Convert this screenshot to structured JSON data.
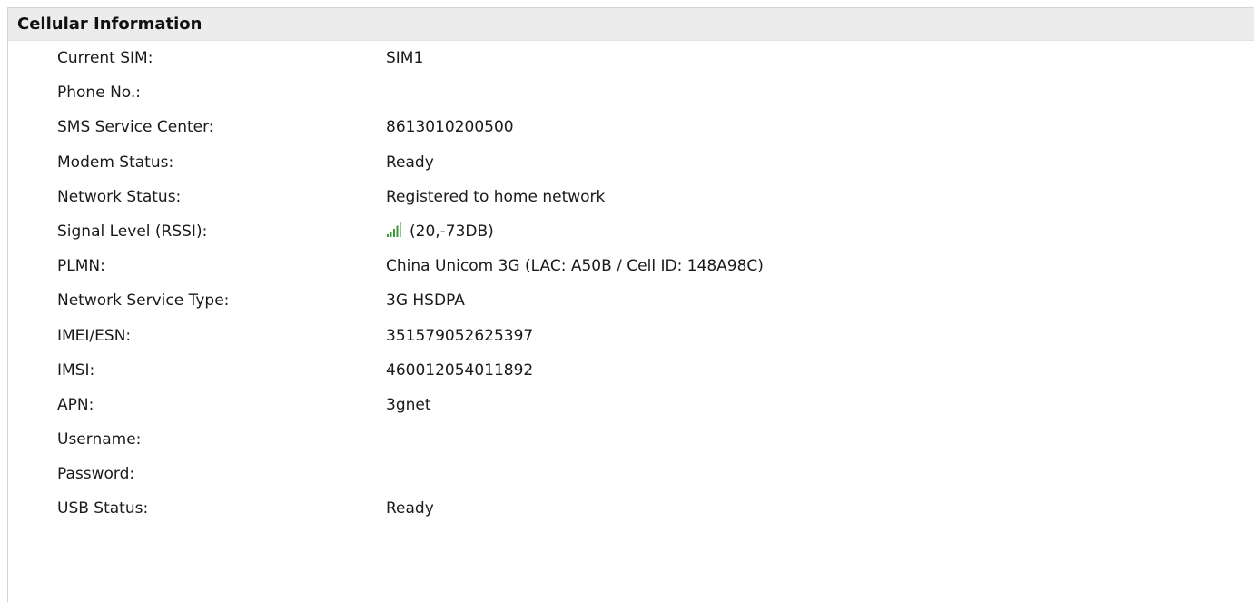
{
  "panel": {
    "title": "Cellular Information"
  },
  "rows": [
    {
      "label": "Current SIM:",
      "value": "SIM1"
    },
    {
      "label": "Phone No.:",
      "value": ""
    },
    {
      "label": "SMS Service Center:",
      "value": "8613010200500"
    },
    {
      "label": "Modem Status:",
      "value": "Ready"
    },
    {
      "label": "Network Status:",
      "value": "Registered to home network"
    },
    {
      "label": "Signal Level (RSSI):",
      "value": "(20,-73DB)",
      "icon": "signal-strength-icon"
    },
    {
      "label": "PLMN:",
      "value": "China Unicom 3G (LAC: A50B / Cell ID: 148A98C)"
    },
    {
      "label": "Network Service Type:",
      "value": "3G HSDPA"
    },
    {
      "label": "IMEI/ESN:",
      "value": "351579052625397"
    },
    {
      "label": "IMSI:",
      "value": "460012054011892"
    },
    {
      "label": "APN:",
      "value": "3gnet"
    },
    {
      "label": "Username:",
      "value": ""
    },
    {
      "label": "Password:",
      "value": ""
    },
    {
      "label": "USB Status:",
      "value": "Ready"
    }
  ],
  "colors": {
    "header_bg": "#ececec",
    "border": "#d4d4d4",
    "signal_green": "#3a9a3a"
  }
}
